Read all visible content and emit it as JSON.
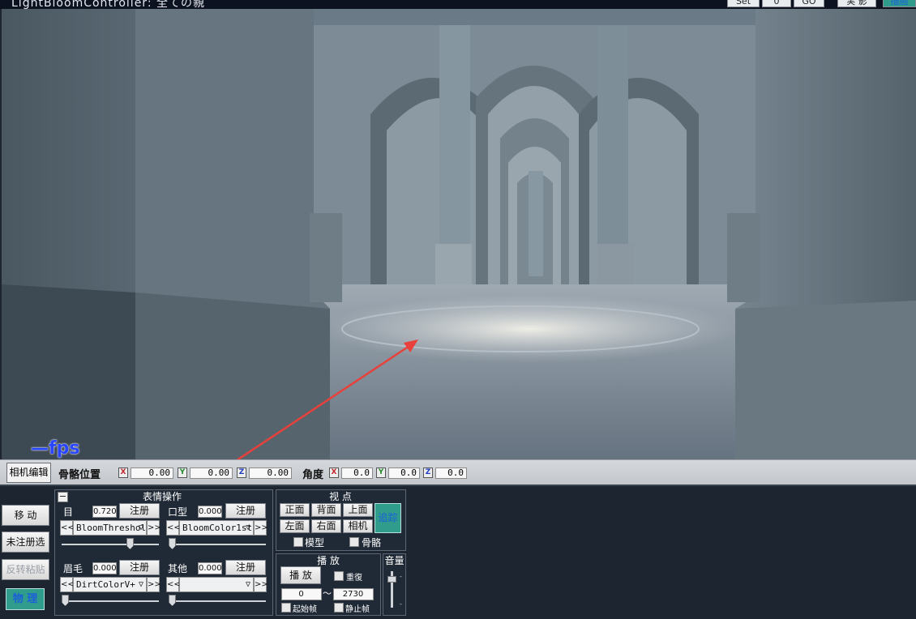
{
  "window": {
    "title": "LightBloomController: 全ての親",
    "set_label": "Set",
    "frame_value": "0",
    "go_label": "GO",
    "render_label": "実 影",
    "mode_label": "描画"
  },
  "viewport": {
    "fps_text": "—fps"
  },
  "bone_bar": {
    "camera_edit_label": "相机编辑",
    "position_label": "骨骼位置",
    "position": {
      "x": "0.00",
      "y": "0.00",
      "z": "0.00"
    },
    "angle_label": "角度",
    "angle": {
      "x": "0.0",
      "y": "0.0",
      "z": "0.0"
    },
    "axis_x": "X",
    "axis_y": "Y",
    "axis_z": "Z"
  },
  "left_buttons": {
    "move": "移 动",
    "unregistered_select": "未注册选",
    "reverse_paste": "反转粘贴",
    "physics": "物 理"
  },
  "expression": {
    "title": "表情操作",
    "collapse": "−",
    "register_label": "注册",
    "prev": "<<",
    "next": ">>",
    "eye": {
      "label": "目",
      "value": "0.720",
      "selected": "BloomThreshold"
    },
    "mouth": {
      "label": "口型",
      "value": "0.000",
      "selected": "BloomColor1st"
    },
    "eyebrow": {
      "label": "眉毛",
      "value": "0.000",
      "selected": "DirtColorV+"
    },
    "other": {
      "label": "其他",
      "value": "0.000",
      "selected": ""
    },
    "levels": {
      "eye": 0.72,
      "mouth": 0.0,
      "eyebrow": 0.0,
      "other": 0.0
    }
  },
  "viewpoint": {
    "title": "视 点",
    "front": "正面",
    "back": "背面",
    "top": "上面",
    "left": "左面",
    "right": "右面",
    "camera": "相机",
    "track": "追踪",
    "model_label": "模型",
    "bone_label": "骨骼"
  },
  "playback": {
    "title": "播 放",
    "play": "播 放",
    "repeat_label": "重復",
    "start_frame": "0",
    "tilde": "〜",
    "end_frame": "2730",
    "start_frame_label": "起始帧",
    "stop_frame_label": "静止帧"
  },
  "volume": {
    "title": "音量",
    "level": 0.85
  },
  "colors": {
    "accent_teal": "#2f9c8c",
    "panel_bg": "#202a36",
    "fps_blue": "#2a45ff",
    "arrow_red": "#e8403a"
  }
}
